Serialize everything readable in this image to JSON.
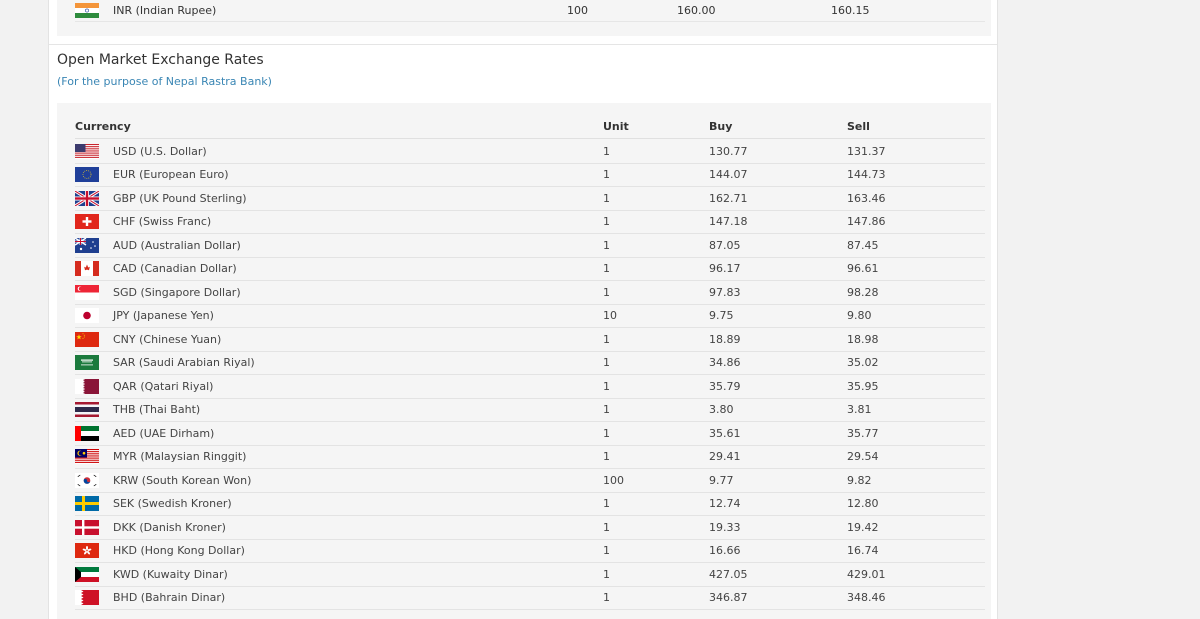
{
  "top_row": {
    "flag": "flag-in",
    "name": "INR (Indian Rupee)",
    "unit": "100",
    "buy": "160.00",
    "sell": "160.15"
  },
  "section": {
    "title": "Open Market Exchange Rates",
    "subtitle": "(For the purpose of Nepal Rastra Bank)"
  },
  "table": {
    "headers": {
      "currency": "Currency",
      "unit": "Unit",
      "buy": "Buy",
      "sell": "Sell"
    },
    "rows": [
      {
        "flag": "flag-us",
        "name": "USD (U.S. Dollar)",
        "unit": "1",
        "buy": "130.77",
        "sell": "131.37"
      },
      {
        "flag": "flag-eu",
        "name": "EUR (European Euro)",
        "unit": "1",
        "buy": "144.07",
        "sell": "144.73"
      },
      {
        "flag": "flag-gb",
        "name": "GBP (UK Pound Sterling)",
        "unit": "1",
        "buy": "162.71",
        "sell": "163.46"
      },
      {
        "flag": "flag-ch",
        "name": "CHF (Swiss Franc)",
        "unit": "1",
        "buy": "147.18",
        "sell": "147.86"
      },
      {
        "flag": "flag-au",
        "name": "AUD (Australian Dollar)",
        "unit": "1",
        "buy": "87.05",
        "sell": "87.45"
      },
      {
        "flag": "flag-ca",
        "name": "CAD (Canadian Dollar)",
        "unit": "1",
        "buy": "96.17",
        "sell": "96.61"
      },
      {
        "flag": "flag-sg",
        "name": "SGD (Singapore Dollar)",
        "unit": "1",
        "buy": "97.83",
        "sell": "98.28"
      },
      {
        "flag": "flag-jp",
        "name": "JPY (Japanese Yen)",
        "unit": "10",
        "buy": "9.75",
        "sell": "9.80"
      },
      {
        "flag": "flag-cn",
        "name": "CNY (Chinese Yuan)",
        "unit": "1",
        "buy": "18.89",
        "sell": "18.98"
      },
      {
        "flag": "flag-sa",
        "name": "SAR (Saudi Arabian Riyal)",
        "unit": "1",
        "buy": "34.86",
        "sell": "35.02"
      },
      {
        "flag": "flag-qa",
        "name": "QAR (Qatari Riyal)",
        "unit": "1",
        "buy": "35.79",
        "sell": "35.95"
      },
      {
        "flag": "flag-th",
        "name": "THB (Thai Baht)",
        "unit": "1",
        "buy": "3.80",
        "sell": "3.81"
      },
      {
        "flag": "flag-ae",
        "name": "AED (UAE Dirham)",
        "unit": "1",
        "buy": "35.61",
        "sell": "35.77"
      },
      {
        "flag": "flag-my",
        "name": "MYR (Malaysian Ringgit)",
        "unit": "1",
        "buy": "29.41",
        "sell": "29.54"
      },
      {
        "flag": "flag-kr",
        "name": "KRW (South Korean Won)",
        "unit": "100",
        "buy": "9.77",
        "sell": "9.82"
      },
      {
        "flag": "flag-se",
        "name": "SEK (Swedish Kroner)",
        "unit": "1",
        "buy": "12.74",
        "sell": "12.80"
      },
      {
        "flag": "flag-dk",
        "name": "DKK (Danish Kroner)",
        "unit": "1",
        "buy": "19.33",
        "sell": "19.42"
      },
      {
        "flag": "flag-hk",
        "name": "HKD (Hong Kong Dollar)",
        "unit": "1",
        "buy": "16.66",
        "sell": "16.74"
      },
      {
        "flag": "flag-kw",
        "name": "KWD (Kuwaity Dinar)",
        "unit": "1",
        "buy": "427.05",
        "sell": "429.01"
      },
      {
        "flag": "flag-bh",
        "name": "BHD (Bahrain Dinar)",
        "unit": "1",
        "buy": "346.87",
        "sell": "348.46"
      }
    ]
  }
}
